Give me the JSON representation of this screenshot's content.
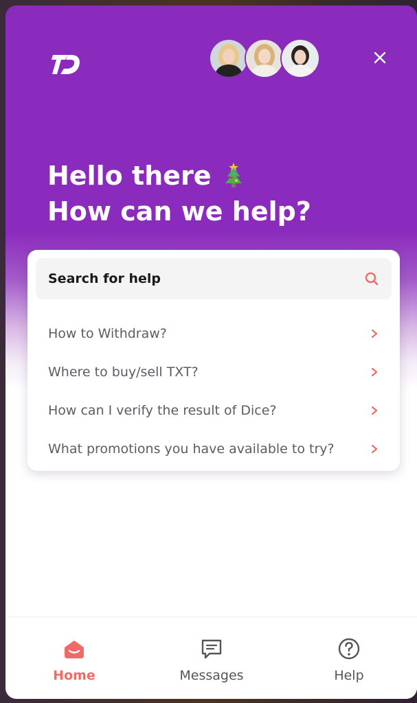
{
  "header": {
    "avatars": [
      {
        "name": "agent-1",
        "hair": "#e6c98a",
        "top": "#222222",
        "bg": "#cfd6dc"
      },
      {
        "name": "agent-2",
        "hair": "#d9b27a",
        "top": "#f2efe9",
        "bg": "#e7e2da"
      },
      {
        "name": "agent-3",
        "hair": "#2b2220",
        "top": "#f5f3f0",
        "bg": "#e9ecef"
      }
    ],
    "brand_color": "#8a2bbd"
  },
  "hero": {
    "line1": "Hello there",
    "line2": "How can we help?"
  },
  "search": {
    "label": "Search for help"
  },
  "faq": [
    {
      "label": "How to Withdraw?"
    },
    {
      "label": "Where to buy/sell TXT?"
    },
    {
      "label": "How can I verify the result of Dice?"
    },
    {
      "label": "What promotions you have available to try?"
    }
  ],
  "tabs": [
    {
      "label": "Home",
      "icon": "home-icon"
    },
    {
      "label": "Messages",
      "icon": "messages-icon"
    },
    {
      "label": "Help",
      "icon": "help-icon"
    }
  ],
  "colors": {
    "accent": "#f06a67",
    "purple": "#8a2bbd"
  }
}
